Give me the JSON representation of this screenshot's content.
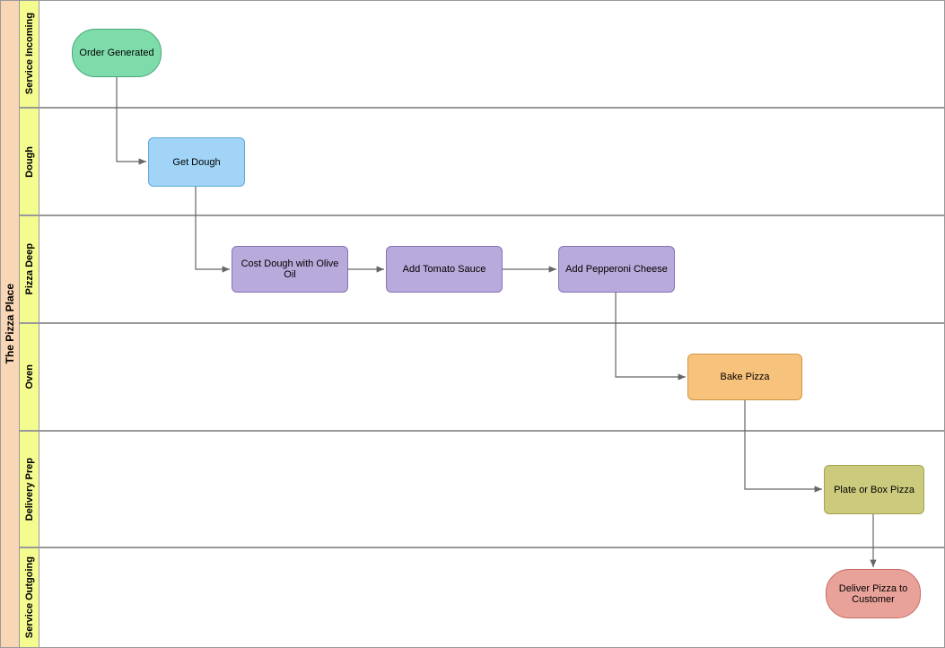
{
  "pool": {
    "title": "The Pizza Place"
  },
  "lanes": {
    "l0": {
      "title": "Service Incoming"
    },
    "l1": {
      "title": "Dough"
    },
    "l2": {
      "title": "Pizza Deep"
    },
    "l3": {
      "title": "Oven"
    },
    "l4": {
      "title": "Delivery Prep"
    },
    "l5": {
      "title": "Service Outgoing"
    }
  },
  "nodes": {
    "n_order": {
      "label": "Order Generated"
    },
    "n_dough": {
      "label": "Get Dough"
    },
    "n_oil": {
      "label": "Cost Dough with Olive Oil"
    },
    "n_sauce": {
      "label": "Add Tomato Sauce"
    },
    "n_pep": {
      "label": "Add Pepperoni Cheese"
    },
    "n_bake": {
      "label": "Bake Pizza"
    },
    "n_plate": {
      "label": "Plate or Box Pizza"
    },
    "n_deliver": {
      "label": "Deliver Pizza to Customer"
    }
  },
  "colors": {
    "green": "#7edcab",
    "blue": "#a1d4f7",
    "purple": "#b8aadb",
    "orange": "#f7c27b",
    "olive": "#cccb7d",
    "rose": "#e9a29a"
  },
  "chart_data": {
    "type": "swimlane-flowchart",
    "pool": "The Pizza Place",
    "lanes": [
      "Service Incoming",
      "Dough",
      "Pizza Deep",
      "Oven",
      "Delivery Prep",
      "Service Outgoing"
    ],
    "nodes": [
      {
        "id": "order",
        "label": "Order Generated",
        "lane": "Service Incoming",
        "shape": "rounded",
        "fill": "#7edcab"
      },
      {
        "id": "dough",
        "label": "Get Dough",
        "lane": "Dough",
        "shape": "rect",
        "fill": "#a1d4f7"
      },
      {
        "id": "oil",
        "label": "Cost Dough with Olive Oil",
        "lane": "Pizza Deep",
        "shape": "rect",
        "fill": "#b8aadb"
      },
      {
        "id": "sauce",
        "label": "Add Tomato Sauce",
        "lane": "Pizza Deep",
        "shape": "rect",
        "fill": "#b8aadb"
      },
      {
        "id": "pep",
        "label": "Add Pepperoni Cheese",
        "lane": "Pizza Deep",
        "shape": "rect",
        "fill": "#b8aadb"
      },
      {
        "id": "bake",
        "label": "Bake Pizza",
        "lane": "Oven",
        "shape": "rect",
        "fill": "#f7c27b"
      },
      {
        "id": "plate",
        "label": "Plate or Box Pizza",
        "lane": "Delivery Prep",
        "shape": "rect",
        "fill": "#cccb7d"
      },
      {
        "id": "deliver",
        "label": "Deliver Pizza to Customer",
        "lane": "Service Outgoing",
        "shape": "rounded",
        "fill": "#e9a29a"
      }
    ],
    "edges": [
      [
        "order",
        "dough"
      ],
      [
        "dough",
        "oil"
      ],
      [
        "oil",
        "sauce"
      ],
      [
        "sauce",
        "pep"
      ],
      [
        "pep",
        "bake"
      ],
      [
        "bake",
        "plate"
      ],
      [
        "plate",
        "deliver"
      ]
    ]
  }
}
